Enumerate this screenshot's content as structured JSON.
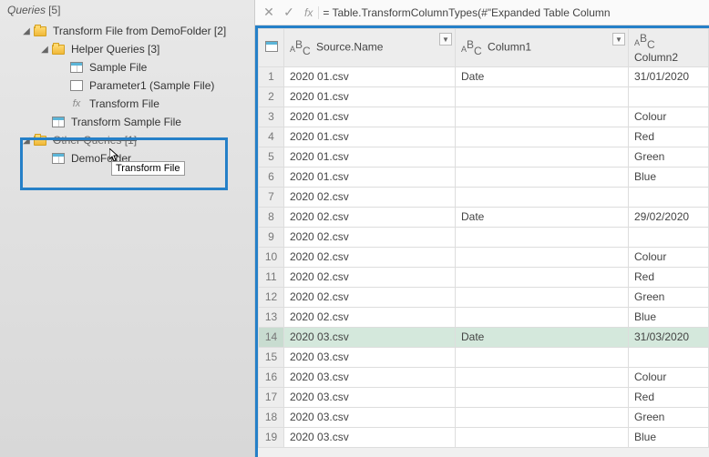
{
  "sidebar": {
    "header_label": "Queries",
    "header_count": "[5]",
    "items": [
      {
        "label": "Transform File from DemoFolder [2]",
        "type": "folder",
        "level": 1,
        "expanded": true
      },
      {
        "label": "Helper Queries [3]",
        "type": "folder",
        "level": 2,
        "expanded": true
      },
      {
        "label": "Sample File",
        "type": "table",
        "level": 3
      },
      {
        "label": "Parameter1 (Sample File)",
        "type": "param",
        "level": 3
      },
      {
        "label": "Transform File",
        "type": "fx",
        "level": 3
      },
      {
        "label": "Transform Sample File",
        "type": "table",
        "level": 2
      },
      {
        "label": "Other Queries [1]",
        "type": "folder",
        "level": 1,
        "expanded": true,
        "strike": true
      },
      {
        "label": "DemoFolder",
        "type": "table",
        "level": 2
      }
    ],
    "tooltip": "Transform File"
  },
  "formula_bar": {
    "cancel": "✕",
    "commit": "✓",
    "fx": "fx",
    "text": "= Table.TransformColumnTypes(#\"Expanded Table Column"
  },
  "grid": {
    "type_badge": "A<sup>B</sup><sub>C</sub>",
    "columns": [
      "Source.Name",
      "Column1",
      "Column2"
    ],
    "rows": [
      {
        "n": 1,
        "src": "2020 01.csv",
        "c1": "Date",
        "c2": "31/01/2020"
      },
      {
        "n": 2,
        "src": "2020 01.csv",
        "c1": "",
        "c2": ""
      },
      {
        "n": 3,
        "src": "2020 01.csv",
        "c1": "",
        "c2": "Colour"
      },
      {
        "n": 4,
        "src": "2020 01.csv",
        "c1": "",
        "c2": "Red"
      },
      {
        "n": 5,
        "src": "2020 01.csv",
        "c1": "",
        "c2": "Green"
      },
      {
        "n": 6,
        "src": "2020 01.csv",
        "c1": "",
        "c2": "Blue"
      },
      {
        "n": 7,
        "src": "2020 02.csv",
        "c1": "",
        "c2": ""
      },
      {
        "n": 8,
        "src": "2020 02.csv",
        "c1": "Date",
        "c2": "29/02/2020"
      },
      {
        "n": 9,
        "src": "2020 02.csv",
        "c1": "",
        "c2": ""
      },
      {
        "n": 10,
        "src": "2020 02.csv",
        "c1": "",
        "c2": "Colour"
      },
      {
        "n": 11,
        "src": "2020 02.csv",
        "c1": "",
        "c2": "Red"
      },
      {
        "n": 12,
        "src": "2020 02.csv",
        "c1": "",
        "c2": "Green"
      },
      {
        "n": 13,
        "src": "2020 02.csv",
        "c1": "",
        "c2": "Blue"
      },
      {
        "n": 14,
        "src": "2020 03.csv",
        "c1": "Date",
        "c2": "31/03/2020",
        "hl": true
      },
      {
        "n": 15,
        "src": "2020 03.csv",
        "c1": "",
        "c2": ""
      },
      {
        "n": 16,
        "src": "2020 03.csv",
        "c1": "",
        "c2": "Colour"
      },
      {
        "n": 17,
        "src": "2020 03.csv",
        "c1": "",
        "c2": "Red"
      },
      {
        "n": 18,
        "src": "2020 03.csv",
        "c1": "",
        "c2": "Green"
      },
      {
        "n": 19,
        "src": "2020 03.csv",
        "c1": "",
        "c2": "Blue"
      }
    ]
  }
}
